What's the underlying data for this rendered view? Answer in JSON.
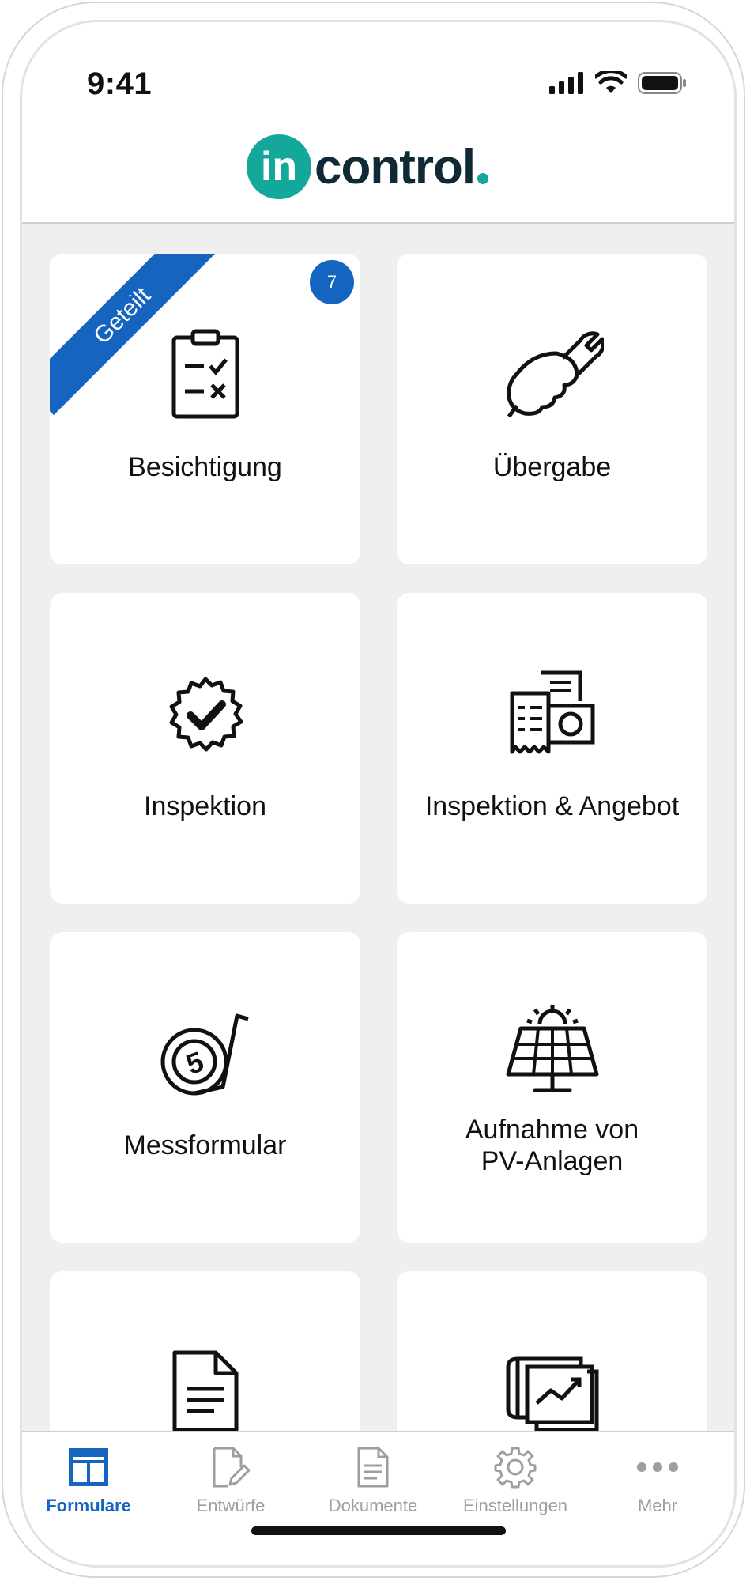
{
  "status_bar": {
    "time": "9:41"
  },
  "header": {
    "logo_circle_text": "in",
    "logo_text": "control"
  },
  "colors": {
    "accent": "#1565c0",
    "brand_teal": "#13a89a",
    "brand_dark": "#0f2a36"
  },
  "cards": [
    {
      "label": "Besichtigung",
      "icon": "clipboard-check-icon",
      "ribbon": "Geteilt",
      "badge": "7"
    },
    {
      "label": "Übergabe",
      "icon": "hand-wrench-icon"
    },
    {
      "label": "Inspektion",
      "icon": "badge-check-icon"
    },
    {
      "label": "Inspektion & Angebot",
      "icon": "receipt-money-icon"
    },
    {
      "label": "Messformular",
      "icon": "tape-measure-icon"
    },
    {
      "label_line1": "Aufnahme von",
      "label_line2": "PV-Anlagen",
      "icon": "solar-panel-icon"
    },
    {
      "label": "",
      "icon": "document-icon"
    },
    {
      "label": "",
      "icon": "chart-stack-icon"
    }
  ],
  "tabbar": {
    "items": [
      {
        "label": "Formulare",
        "icon": "forms-icon",
        "active": true
      },
      {
        "label": "Entwürfe",
        "icon": "draft-edit-icon",
        "active": false
      },
      {
        "label": "Dokumente",
        "icon": "document-icon",
        "active": false
      },
      {
        "label": "Einstellungen",
        "icon": "gear-icon",
        "active": false
      },
      {
        "label": "Mehr",
        "icon": "more-dots-icon",
        "active": false
      }
    ]
  }
}
